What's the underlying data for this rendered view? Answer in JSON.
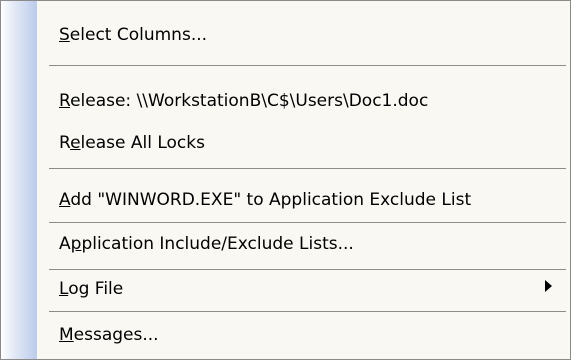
{
  "menu": {
    "items": [
      {
        "key": "S",
        "rest": "elect Columns..."
      },
      {
        "pre": "",
        "key": "R",
        "rest": "elease: \\\\WorkstationB\\C$\\Users\\Doc1.doc"
      },
      {
        "pre": "R",
        "key": "e",
        "rest": "lease All Locks"
      },
      {
        "key": "A",
        "rest": "dd \"WINWORD.EXE\" to Application Exclude List"
      },
      {
        "pre": "A",
        "key": "p",
        "rest": "plication Include/Exclude Lists..."
      },
      {
        "key": "L",
        "rest": "og File",
        "submenu_icon": "submenu-arrow-icon"
      },
      {
        "key": "M",
        "rest": "essages..."
      }
    ]
  }
}
